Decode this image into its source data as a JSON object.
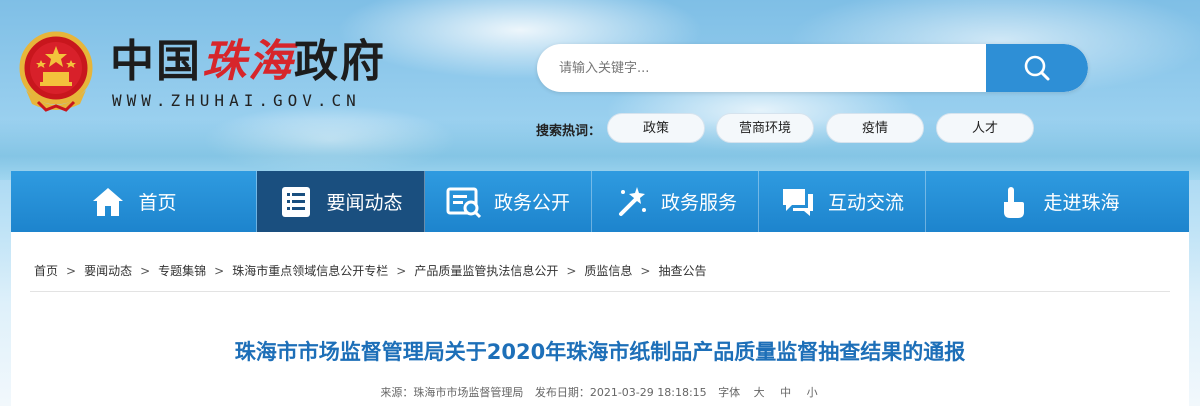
{
  "header": {
    "title_part1": "中国",
    "title_part2": "珠海",
    "title_part3": "政府",
    "url": "WWW.ZHUHAI.GOV.CN"
  },
  "search": {
    "placeholder": "请输入关键字...",
    "hot_label": "搜索热词：",
    "hot_words": [
      "政策",
      "营商环境",
      "疫情",
      "人才"
    ]
  },
  "nav": {
    "items": [
      {
        "label": "首页",
        "icon": "home-icon"
      },
      {
        "label": "要闻动态",
        "icon": "news-list-icon"
      },
      {
        "label": "政务公开",
        "icon": "disclosure-icon"
      },
      {
        "label": "政务服务",
        "icon": "service-magic-icon"
      },
      {
        "label": "互动交流",
        "icon": "chat-icon"
      },
      {
        "label": "走进珠海",
        "icon": "hand-pointer-icon"
      }
    ],
    "active_index": 1
  },
  "breadcrumb": [
    "首页",
    "要闻动态",
    "专题集锦",
    "珠海市重点领域信息公开专栏",
    "产品质量监管执法信息公开",
    "质监信息",
    "抽查公告"
  ],
  "article": {
    "title": "珠海市市场监督管理局关于2020年珠海市纸制品产品质量监督抽查结果的通报",
    "source": "来源：珠海市市场监督管理局",
    "date": "发布日期：2021-03-29 18:18:15",
    "font_label": "字体",
    "font_large": "大",
    "font_medium": "中",
    "font_small": "小"
  },
  "colors": {
    "nav_bg": "#2590d8",
    "nav_active": "#1a4f7f",
    "title_blue": "#1d6fb8",
    "accent_red": "#d7262b"
  }
}
